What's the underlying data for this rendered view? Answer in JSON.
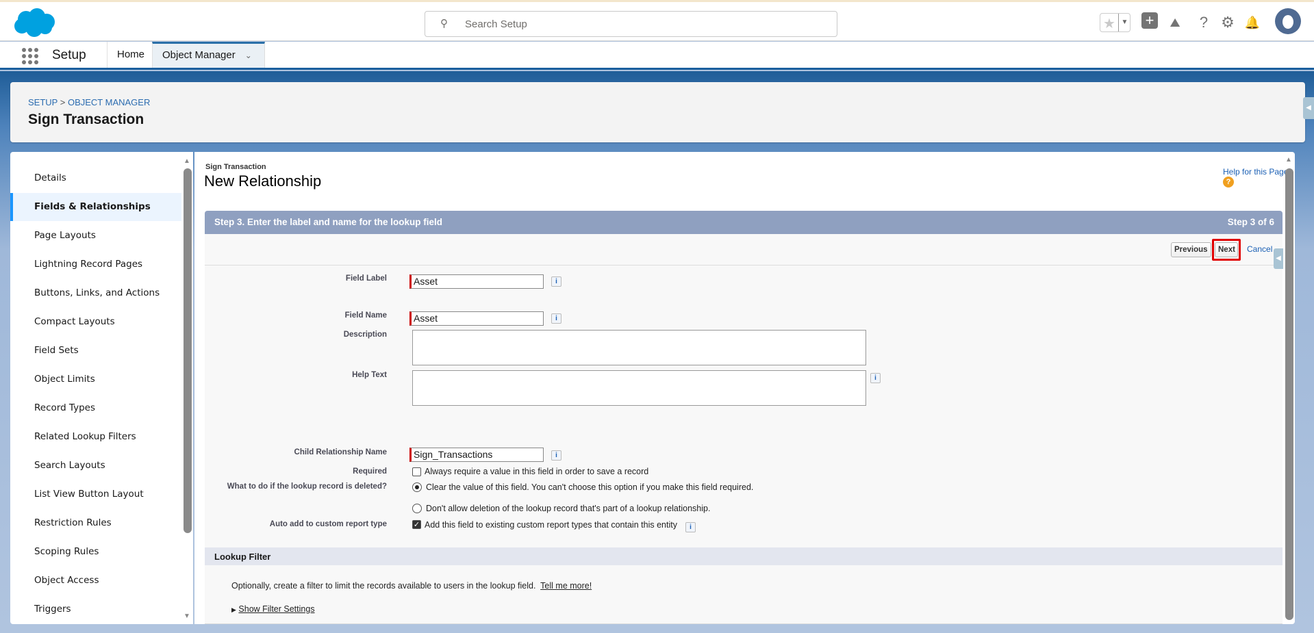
{
  "topbar": {
    "search_placeholder": "Search Setup",
    "icons": [
      "favorites-star-icon",
      "favorites-dropdown-icon",
      "global-add-icon",
      "trailhead-icon",
      "help-icon",
      "setup-gear-icon",
      "notifications-bell-icon",
      "user-avatar"
    ]
  },
  "nav": {
    "app_name": "Setup",
    "tabs": [
      {
        "label": "Home"
      },
      {
        "label": "Object Manager",
        "active": true
      }
    ]
  },
  "header": {
    "breadcrumb": [
      "SETUP",
      "OBJECT MANAGER"
    ],
    "breadcrumb_sep": ">",
    "title": "Sign Transaction"
  },
  "sidebar": {
    "items": [
      {
        "label": "Details"
      },
      {
        "label": "Fields & Relationships",
        "active": true
      },
      {
        "label": "Page Layouts"
      },
      {
        "label": "Lightning Record Pages"
      },
      {
        "label": "Buttons, Links, and Actions"
      },
      {
        "label": "Compact Layouts"
      },
      {
        "label": "Field Sets"
      },
      {
        "label": "Object Limits"
      },
      {
        "label": "Record Types"
      },
      {
        "label": "Related Lookup Filters"
      },
      {
        "label": "Search Layouts"
      },
      {
        "label": "List View Button Layout"
      },
      {
        "label": "Restriction Rules"
      },
      {
        "label": "Scoping Rules"
      },
      {
        "label": "Object Access"
      },
      {
        "label": "Triggers"
      }
    ]
  },
  "main": {
    "object_name": "Sign Transaction",
    "page_title": "New Relationship",
    "help_link": "Help for this Page",
    "step_title": "Step 3. Enter the label and name for the lookup field",
    "step_count": "Step 3 of 6",
    "buttons": {
      "previous": "Previous",
      "next": "Next",
      "cancel": "Cancel"
    },
    "highlight_color": "#e00000",
    "fields": {
      "field_label": {
        "label": "Field Label",
        "value": "Asset"
      },
      "field_name": {
        "label": "Field Name",
        "value": "Asset"
      },
      "description": {
        "label": "Description",
        "value": ""
      },
      "help_text": {
        "label": "Help Text",
        "value": ""
      },
      "child_relationship": {
        "label": "Child Relationship Name",
        "value": "Sign_Transactions"
      },
      "required": {
        "label": "Required",
        "text": "Always require a value in this field in order to save a record",
        "checked": false
      },
      "on_delete": {
        "label": "What to do if the lookup record is deleted?",
        "options": [
          {
            "text": "Clear the value of this field. You can't choose this option if you make this field required.",
            "selected": true
          },
          {
            "text": "Don't allow deletion of the lookup record that's part of a lookup relationship.",
            "selected": false
          }
        ]
      },
      "auto_add": {
        "label": "Auto add to custom report type",
        "text": "Add this field to existing custom report types that contain this entity",
        "checked": true
      }
    },
    "lookup_filter": {
      "title": "Lookup Filter",
      "description": "Optionally, create a filter to limit the records available to users in the lookup field.",
      "tell_more": "Tell me more!",
      "show_settings": "Show Filter Settings"
    }
  }
}
